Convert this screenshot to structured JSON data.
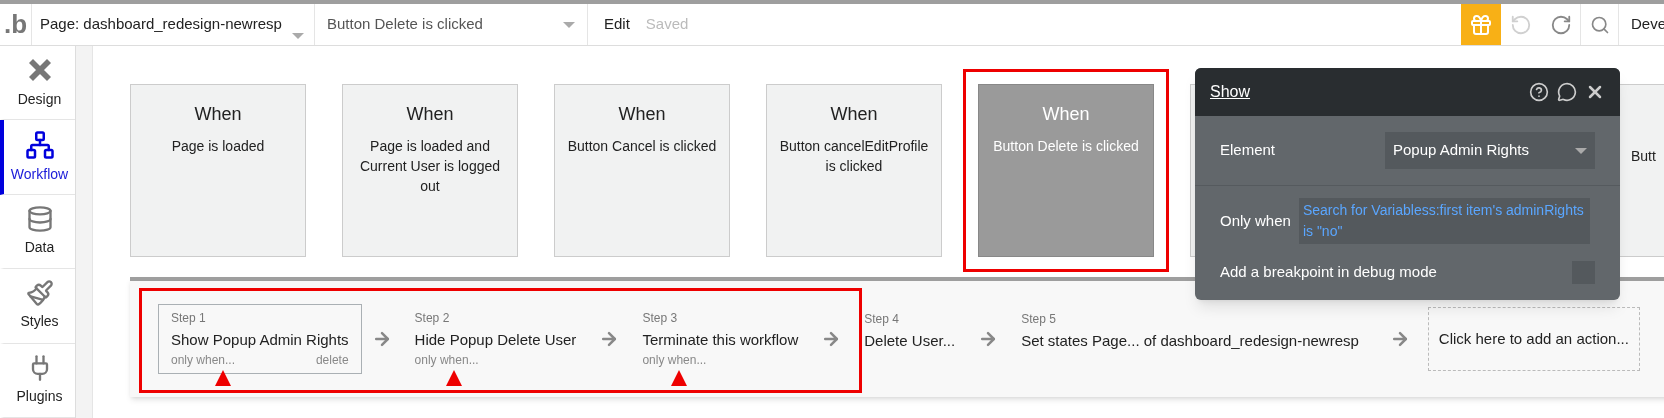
{
  "topbar": {
    "logo": ".b",
    "page_selector": "Page: dashboard_redesign-newresp",
    "event_selector": "Button Delete is clicked",
    "edit": "Edit",
    "save_status": "Saved",
    "undo_disabled": true,
    "redo_disabled": false,
    "cut_label": "Deve"
  },
  "sidebar": {
    "items": [
      {
        "label": "Design",
        "selected": false
      },
      {
        "label": "Workflow",
        "selected": true
      },
      {
        "label": "Data",
        "selected": false
      },
      {
        "label": "Styles",
        "selected": false
      },
      {
        "label": "Plugins",
        "selected": false
      }
    ]
  },
  "events": [
    {
      "heading": "When",
      "text": "Page is loaded",
      "selected": false
    },
    {
      "heading": "When",
      "text": "Page is loaded and Current User is logged out",
      "selected": false
    },
    {
      "heading": "When",
      "text": "Button Cancel is clicked",
      "selected": false
    },
    {
      "heading": "When",
      "text": "Button cancelEditProfile is clicked",
      "selected": false
    },
    {
      "heading": "When",
      "text": "Button Delete is clicked",
      "selected": true
    },
    {
      "text": "Butt",
      "selected": false
    }
  ],
  "steps": [
    {
      "label": "Step 1",
      "title": "Show Popup Admin Rights",
      "condition": "only when...",
      "delete": "delete",
      "selected": true
    },
    {
      "label": "Step 2",
      "title": "Hide Popup Delete User",
      "condition": "only when...",
      "selected": false
    },
    {
      "label": "Step 3",
      "title": "Terminate this workflow",
      "condition": "only when...",
      "selected": false
    },
    {
      "label": "Step 4",
      "title": "Delete User...",
      "selected": false
    },
    {
      "label": "Step 5",
      "title": "Set states Page... of dashboard_redesign-newresp",
      "selected": false
    }
  ],
  "add_action": "Click here to add an action...",
  "popup": {
    "title": "Show",
    "element_label": "Element",
    "element_value": "Popup Admin Rights",
    "only_when_label": "Only when",
    "only_when_value": "Search for Variabless:first item's adminRights is \"no\"",
    "breakpoint_label": "Add a breakpoint in debug mode",
    "breakpoint_checked": false
  }
}
